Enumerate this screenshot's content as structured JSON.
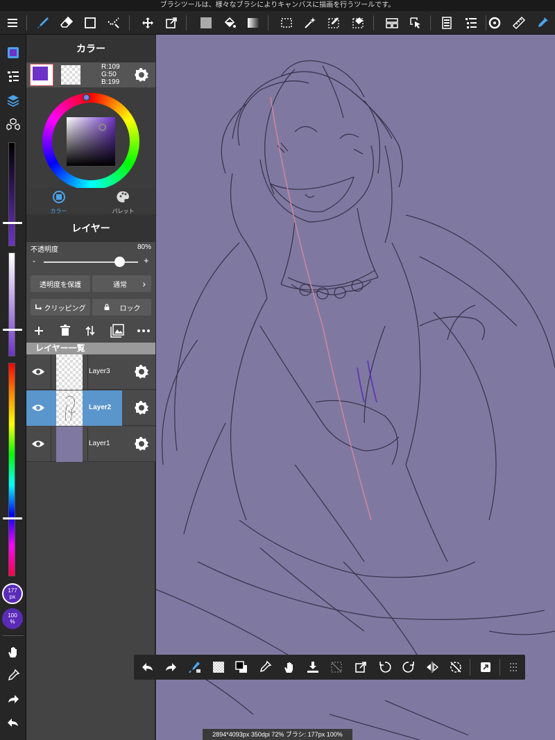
{
  "hint": "ブラシツールは、様々なブラシによりキャンバスに描画を行うツールです。",
  "toolbar": {
    "icons": [
      "menu-icon",
      "brush-icon",
      "eraser-icon",
      "shape-icon",
      "dot-icon",
      "move-icon",
      "transform-icon",
      "fill-color-icon",
      "bucket-icon",
      "gradient-icon",
      "select-rect-icon",
      "magic-wand-icon",
      "select-pen-icon",
      "select-eraser-icon",
      "filter-icon",
      "operation-icon",
      "material-icon",
      "layer-list-icon",
      "undo-circle-icon",
      "ruler-icon",
      "eyedropper-icon"
    ]
  },
  "color_panel": {
    "title": "カラー",
    "rgb_r": "R:109",
    "rgb_g": "G:50",
    "rgb_b": "B:199",
    "primary_color": "#6d32c7",
    "tab_color": "カラー",
    "tab_palette": "パレット"
  },
  "layer_panel": {
    "title": "レイヤー",
    "opacity_label": "不透明度",
    "opacity_value": "80%",
    "opacity_fraction": 0.8,
    "minus": "-",
    "plus": "+",
    "protect_alpha": "透明度を保護",
    "blend_mode": "通常",
    "clipping": "クリッピング",
    "lock": "ロック",
    "list_title": "レイヤー一覧",
    "layers": [
      {
        "name": "Layer3",
        "selected": false
      },
      {
        "name": "Layer2",
        "selected": true
      },
      {
        "name": "Layer1",
        "selected": false
      }
    ]
  },
  "leftbar": {
    "brush_size": "177",
    "brush_size_unit": "px",
    "brush_opacity": "100",
    "brush_opacity_unit": "%"
  },
  "status": "2894*4093px 350dpi 72% ブラシ: 177px 100%",
  "canvas_color": "#7f79a2"
}
